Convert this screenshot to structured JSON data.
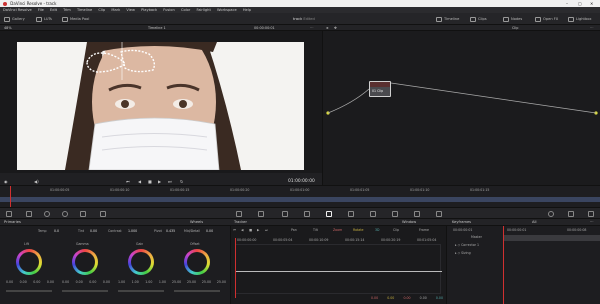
{
  "app": {
    "title": "DaVinci Resolve - track",
    "menu": [
      "DaVinci Resolve",
      "File",
      "Edit",
      "Trim",
      "Timeline",
      "Clip",
      "Mark",
      "View",
      "Playback",
      "Fusion",
      "Color",
      "Fairlight",
      "Workspace",
      "Help"
    ]
  },
  "toolbar": {
    "left": [
      "Gallery",
      "LUTs",
      "Media Pool"
    ],
    "center_title": "track",
    "center_sub": "Edited",
    "right": [
      "Timeline",
      "Clips",
      "Nodes",
      "Open FX",
      "Lightbox"
    ]
  },
  "viewer": {
    "zoom": "48%",
    "timeline_name": "Timeline 1",
    "timecode": "00:00:00:01",
    "timecode_big": "01:00:00:00",
    "clip_label": "Clip"
  },
  "nodes": {
    "node_label": "01 Clip"
  },
  "timeline": {
    "ticks": [
      "01:00:00:00",
      "01:00:00:05",
      "01:00:00:10",
      "01:00:00:15",
      "01:00:00:20",
      "01:00:01:00",
      "01:00:01:05",
      "01:00:01:10",
      "01:00:01:15",
      "01:00:01:20"
    ]
  },
  "primaries": {
    "title": "Primaries",
    "mode": "Wheels",
    "temp_label": "Temp",
    "temp": "0.0",
    "tint_label": "Tint",
    "tint": "0.00",
    "contrast_label": "Contrast",
    "contrast": "1.000",
    "pivot_label": "Pivot",
    "pivot": "0.435",
    "mid_label": "Mid/Detail",
    "mid": "0.00",
    "wheels": [
      {
        "name": "Lift",
        "vals": [
          "0.00",
          "0.00",
          "0.00",
          "0.00"
        ]
      },
      {
        "name": "Gamma",
        "vals": [
          "0.00",
          "0.00",
          "0.00",
          "0.00"
        ]
      },
      {
        "name": "Gain",
        "vals": [
          "1.00",
          "1.00",
          "1.00",
          "1.00"
        ]
      },
      {
        "name": "Offset",
        "vals": [
          "25.00",
          "25.00",
          "25.00",
          "25.00"
        ]
      }
    ]
  },
  "tracker": {
    "title": "Tracker",
    "mode": "Window",
    "buttons": [
      "Pan",
      "Tilt",
      "Zoom",
      "Rotate",
      "3D"
    ],
    "clip": "Clip",
    "frame": "Frame",
    "ticks": [
      "00:00:00:00",
      "00:00:05:04",
      "00:00:10:09",
      "00:00:15:14",
      "00:00:20:19",
      "00:01:05:04"
    ],
    "readout": [
      "0.00",
      "0.00",
      "0.00",
      "0.00",
      "0.00"
    ]
  },
  "keyframes": {
    "title": "Keyframes",
    "filter": "All",
    "timecode": "00:00:00:01",
    "tick1": "00:00:00:01",
    "tick2": "00:00:00:08",
    "tracks": [
      "Master",
      "Corrector 1",
      "Sizing"
    ]
  }
}
